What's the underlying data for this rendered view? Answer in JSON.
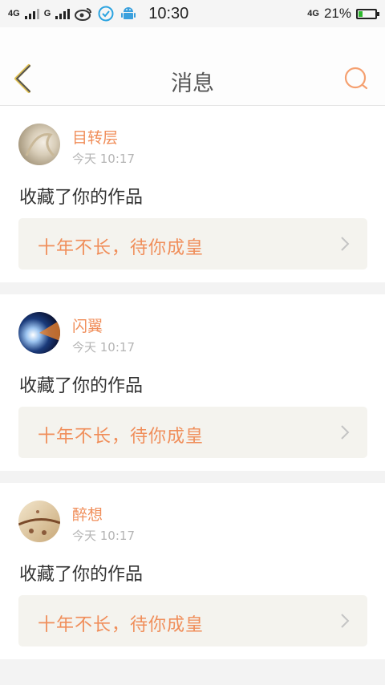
{
  "status_bar": {
    "network1": "4G",
    "network2": "G",
    "time": "10:30",
    "network3": "4G",
    "battery_pct": "21%",
    "battery_level": 0.21
  },
  "header": {
    "title": "消息",
    "back_icon": "chevron-left-icon",
    "search_icon": "search-icon",
    "accent": "#f08e5a"
  },
  "messages": [
    {
      "user": "目转层",
      "time": "今天 10:17",
      "action": "收藏了你的作品",
      "work_title": "十年不长，待你成皇"
    },
    {
      "user": "闪翼",
      "time": "今天 10:17",
      "action": "收藏了你的作品",
      "work_title": "十年不长，待你成皇"
    },
    {
      "user": "醉想",
      "time": "今天 10:17",
      "action": "收藏了你的作品",
      "work_title": "十年不长，待你成皇"
    }
  ]
}
